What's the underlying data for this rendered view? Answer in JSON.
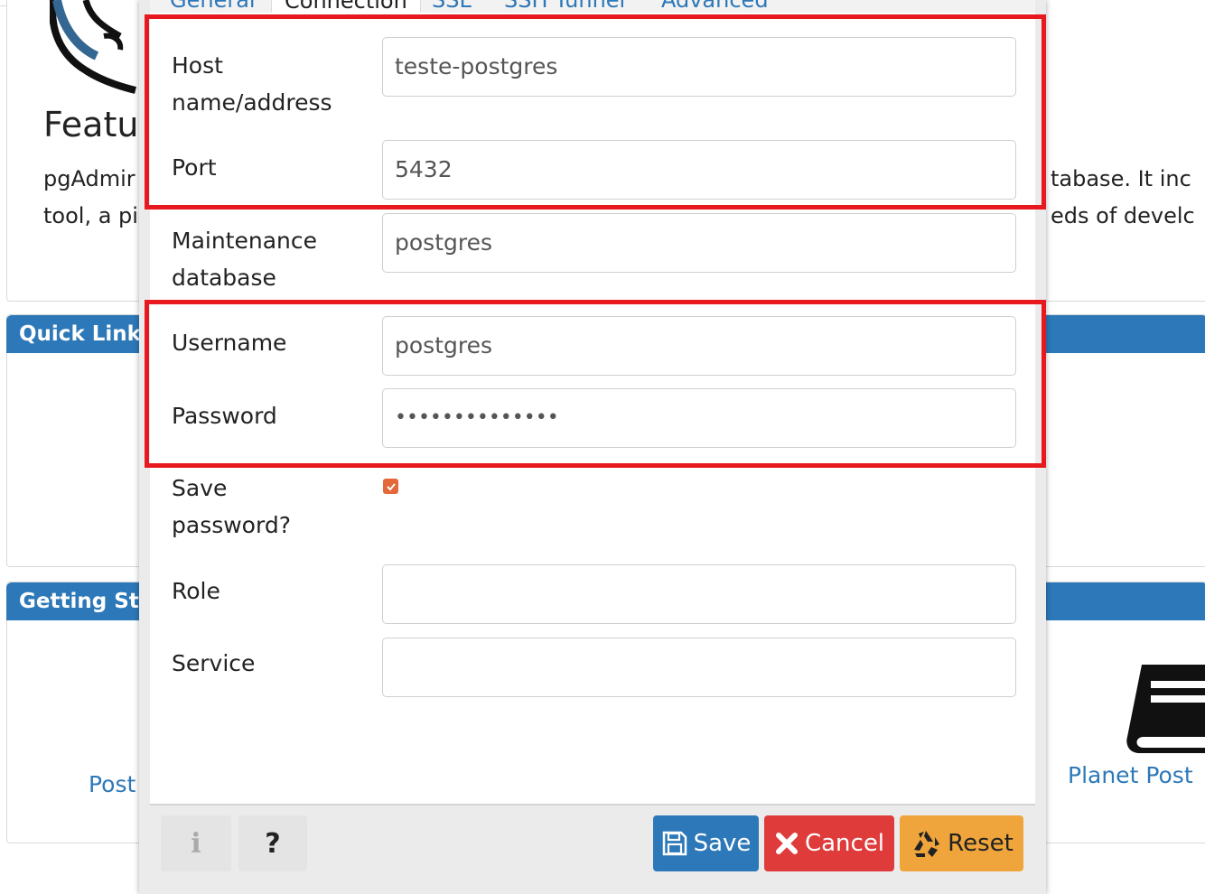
{
  "background": {
    "features_heading": "Featu",
    "description_line1_left": "pgAdmir",
    "description_line2_left": "tool, a pi",
    "description_line1_right": "tabase. It inc",
    "description_line2_right": "eds of develc",
    "quick_links_title": "Quick Link",
    "getting_started_title": "Getting Sta",
    "postgres_link": "Post",
    "planet_link": "Planet Post"
  },
  "dialog": {
    "tabs": [
      "General",
      "Connection",
      "SSL",
      "SSH Tunnel",
      "Advanced"
    ],
    "fields": {
      "host": {
        "label": "Host name/address",
        "value": "teste-postgres"
      },
      "port": {
        "label": "Port",
        "value": "5432"
      },
      "maintenance_db": {
        "label": "Maintenance database",
        "value": "postgres"
      },
      "username": {
        "label": "Username",
        "value": "postgres"
      },
      "password": {
        "label": "Password",
        "value": "••••••••••••••"
      },
      "save_password": {
        "label": "Save password?",
        "checked": true
      },
      "role": {
        "label": "Role",
        "value": ""
      },
      "service": {
        "label": "Service",
        "value": ""
      }
    },
    "footer": {
      "info_label": "i",
      "help_label": "?",
      "save_label": "Save",
      "cancel_label": "Cancel",
      "reset_label": "Reset"
    }
  },
  "colors": {
    "primary": "#2d78b8",
    "danger": "#df3b3b",
    "warning": "#efa53b",
    "highlight": "#e8181f",
    "checkbox": "#e3683a"
  },
  "icons": [
    "elephant-logo-icon",
    "book-icon",
    "save-icon",
    "cancel-icon",
    "reset-icon",
    "info-icon",
    "help-icon",
    "check-icon"
  ]
}
